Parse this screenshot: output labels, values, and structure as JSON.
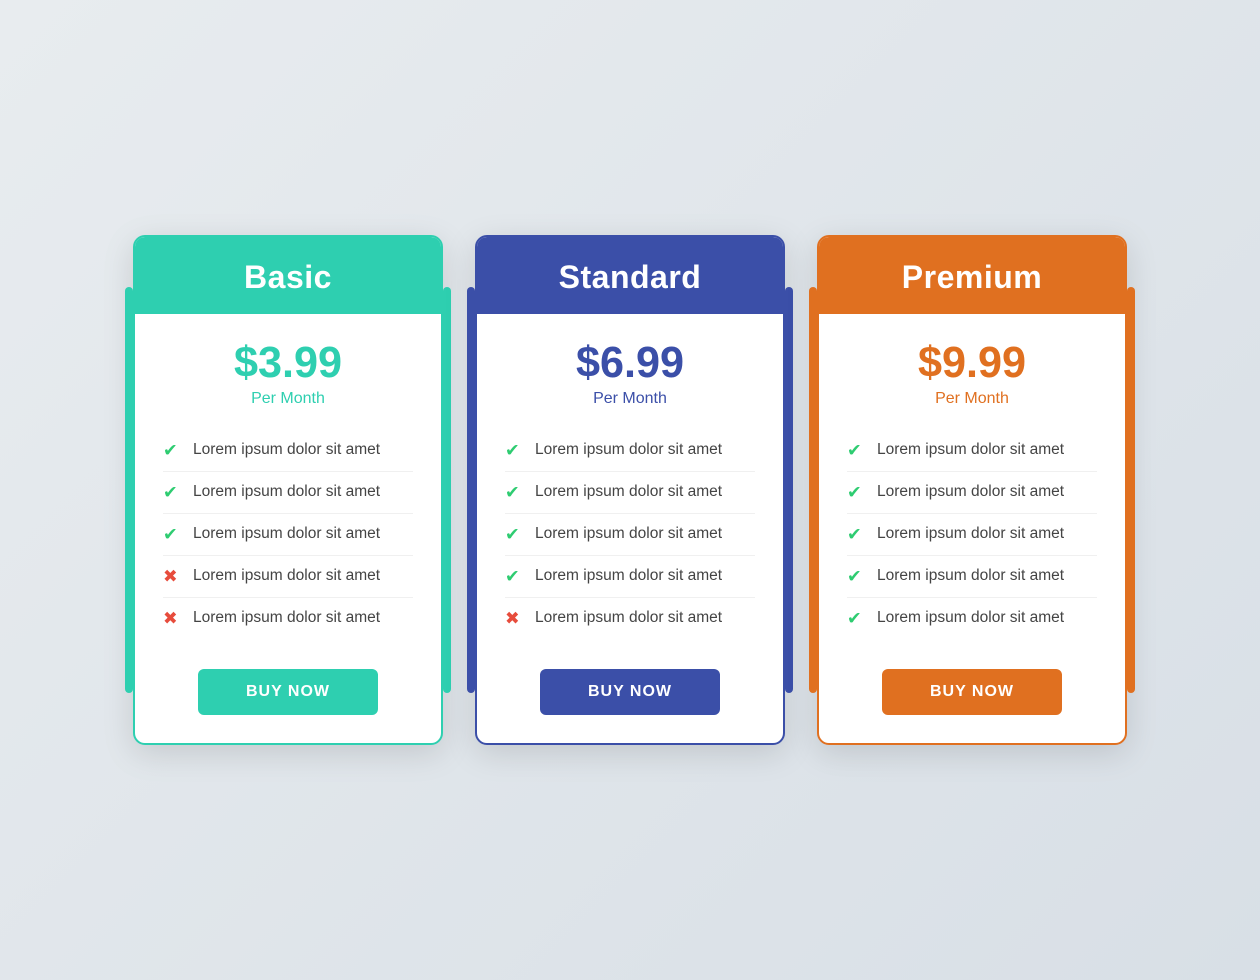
{
  "plans": [
    {
      "id": "basic",
      "name": "Basic",
      "price": "$3.99",
      "period": "Per Month",
      "features": [
        {
          "text": "Lorem ipsum dolor sit amet",
          "included": true
        },
        {
          "text": "Lorem ipsum dolor sit amet",
          "included": true
        },
        {
          "text": "Lorem ipsum dolor sit amet",
          "included": true
        },
        {
          "text": "Lorem ipsum dolor sit amet",
          "included": false
        },
        {
          "text": "Lorem ipsum dolor sit amet",
          "included": false
        }
      ],
      "button_label": "BUY NOW",
      "accent_color": "#2ecfb0"
    },
    {
      "id": "standard",
      "name": "Standard",
      "price": "$6.99",
      "period": "Per Month",
      "features": [
        {
          "text": "Lorem ipsum dolor sit amet",
          "included": true
        },
        {
          "text": "Lorem ipsum dolor sit amet",
          "included": true
        },
        {
          "text": "Lorem ipsum dolor sit amet",
          "included": true
        },
        {
          "text": "Lorem ipsum dolor sit amet",
          "included": true
        },
        {
          "text": "Lorem ipsum dolor sit amet",
          "included": false
        }
      ],
      "button_label": "BUY NOW",
      "accent_color": "#3b4fa8"
    },
    {
      "id": "premium",
      "name": "Premium",
      "price": "$9.99",
      "period": "Per Month",
      "features": [
        {
          "text": "Lorem ipsum dolor sit amet",
          "included": true
        },
        {
          "text": "Lorem ipsum dolor sit amet",
          "included": true
        },
        {
          "text": "Lorem ipsum dolor sit amet",
          "included": true
        },
        {
          "text": "Lorem ipsum dolor sit amet",
          "included": true
        },
        {
          "text": "Lorem ipsum dolor sit amet",
          "included": true
        }
      ],
      "button_label": "BUY NOW",
      "accent_color": "#e07020"
    }
  ]
}
